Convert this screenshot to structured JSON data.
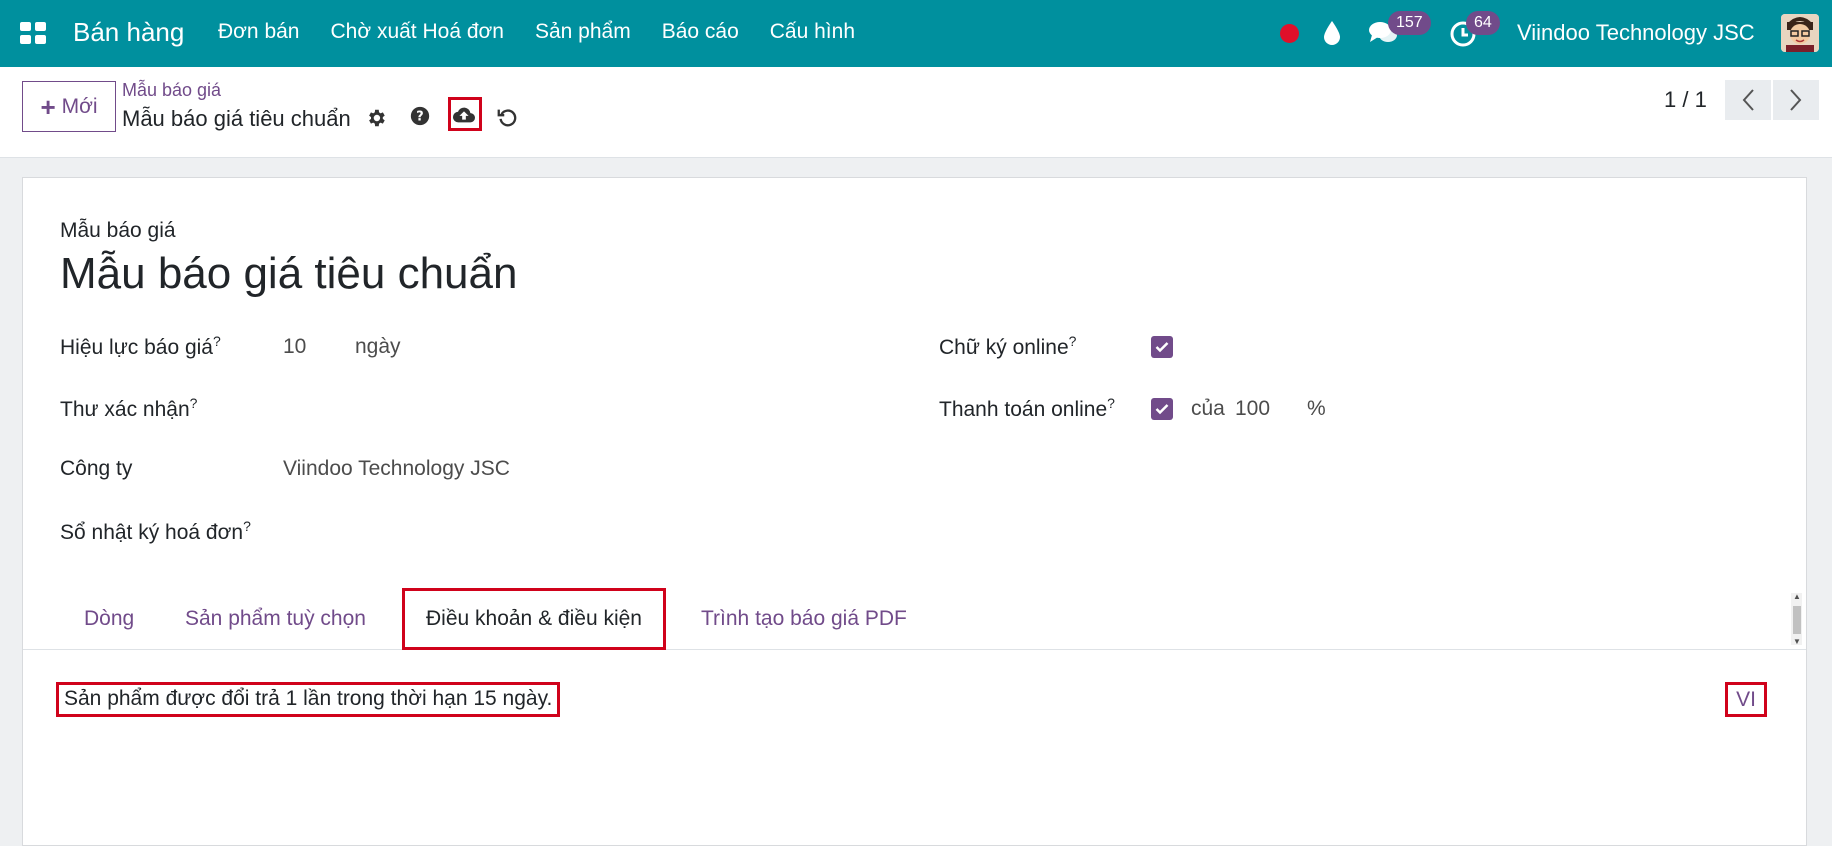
{
  "navbar": {
    "brand": "Bán hàng",
    "menu": [
      "Đơn bán",
      "Chờ xuất Hoá đơn",
      "Sản phẩm",
      "Báo cáo",
      "Cấu hình"
    ],
    "messages_count": "157",
    "activities_count": "64",
    "company": "Viindoo Technology JSC",
    "colors": {
      "bar": "#00909e",
      "badge": "#714b8a",
      "record": "#e0102a"
    }
  },
  "control": {
    "new_button": "Mới",
    "breadcrumb_parent": "Mẫu báo giá",
    "breadcrumb_current": "Mẫu báo giá tiêu chuẩn",
    "pager": "1 / 1"
  },
  "form": {
    "model_label": "Mẫu báo giá",
    "title": "Mẫu báo giá tiêu chuẩn",
    "left_fields": {
      "validity_label": "Hiệu lực báo giá",
      "validity_value": "10",
      "validity_unit": "ngày",
      "confirm_mail_label": "Thư xác nhận",
      "company_label": "Công ty",
      "company_value": "Viindoo Technology JSC",
      "journal_label": "Sổ nhật ký hoá đơn"
    },
    "right_fields": {
      "online_signature_label": "Chữ ký online",
      "online_signature_checked": true,
      "online_payment_label": "Thanh toán online",
      "online_payment_checked": true,
      "payment_prefix": "của",
      "payment_value": "100",
      "payment_unit": "%"
    },
    "help_mark": "?"
  },
  "tabs": [
    "Dòng",
    "Sản phẩm tuỳ chọn",
    "Điều khoản & điều kiện",
    "Trình tạo báo giá PDF"
  ],
  "active_tab": "Điều khoản & điều kiện",
  "terms": {
    "text": "Sản phẩm được đổi trả 1 lần trong thời hạn 15 ngày.",
    "language": "VI"
  }
}
